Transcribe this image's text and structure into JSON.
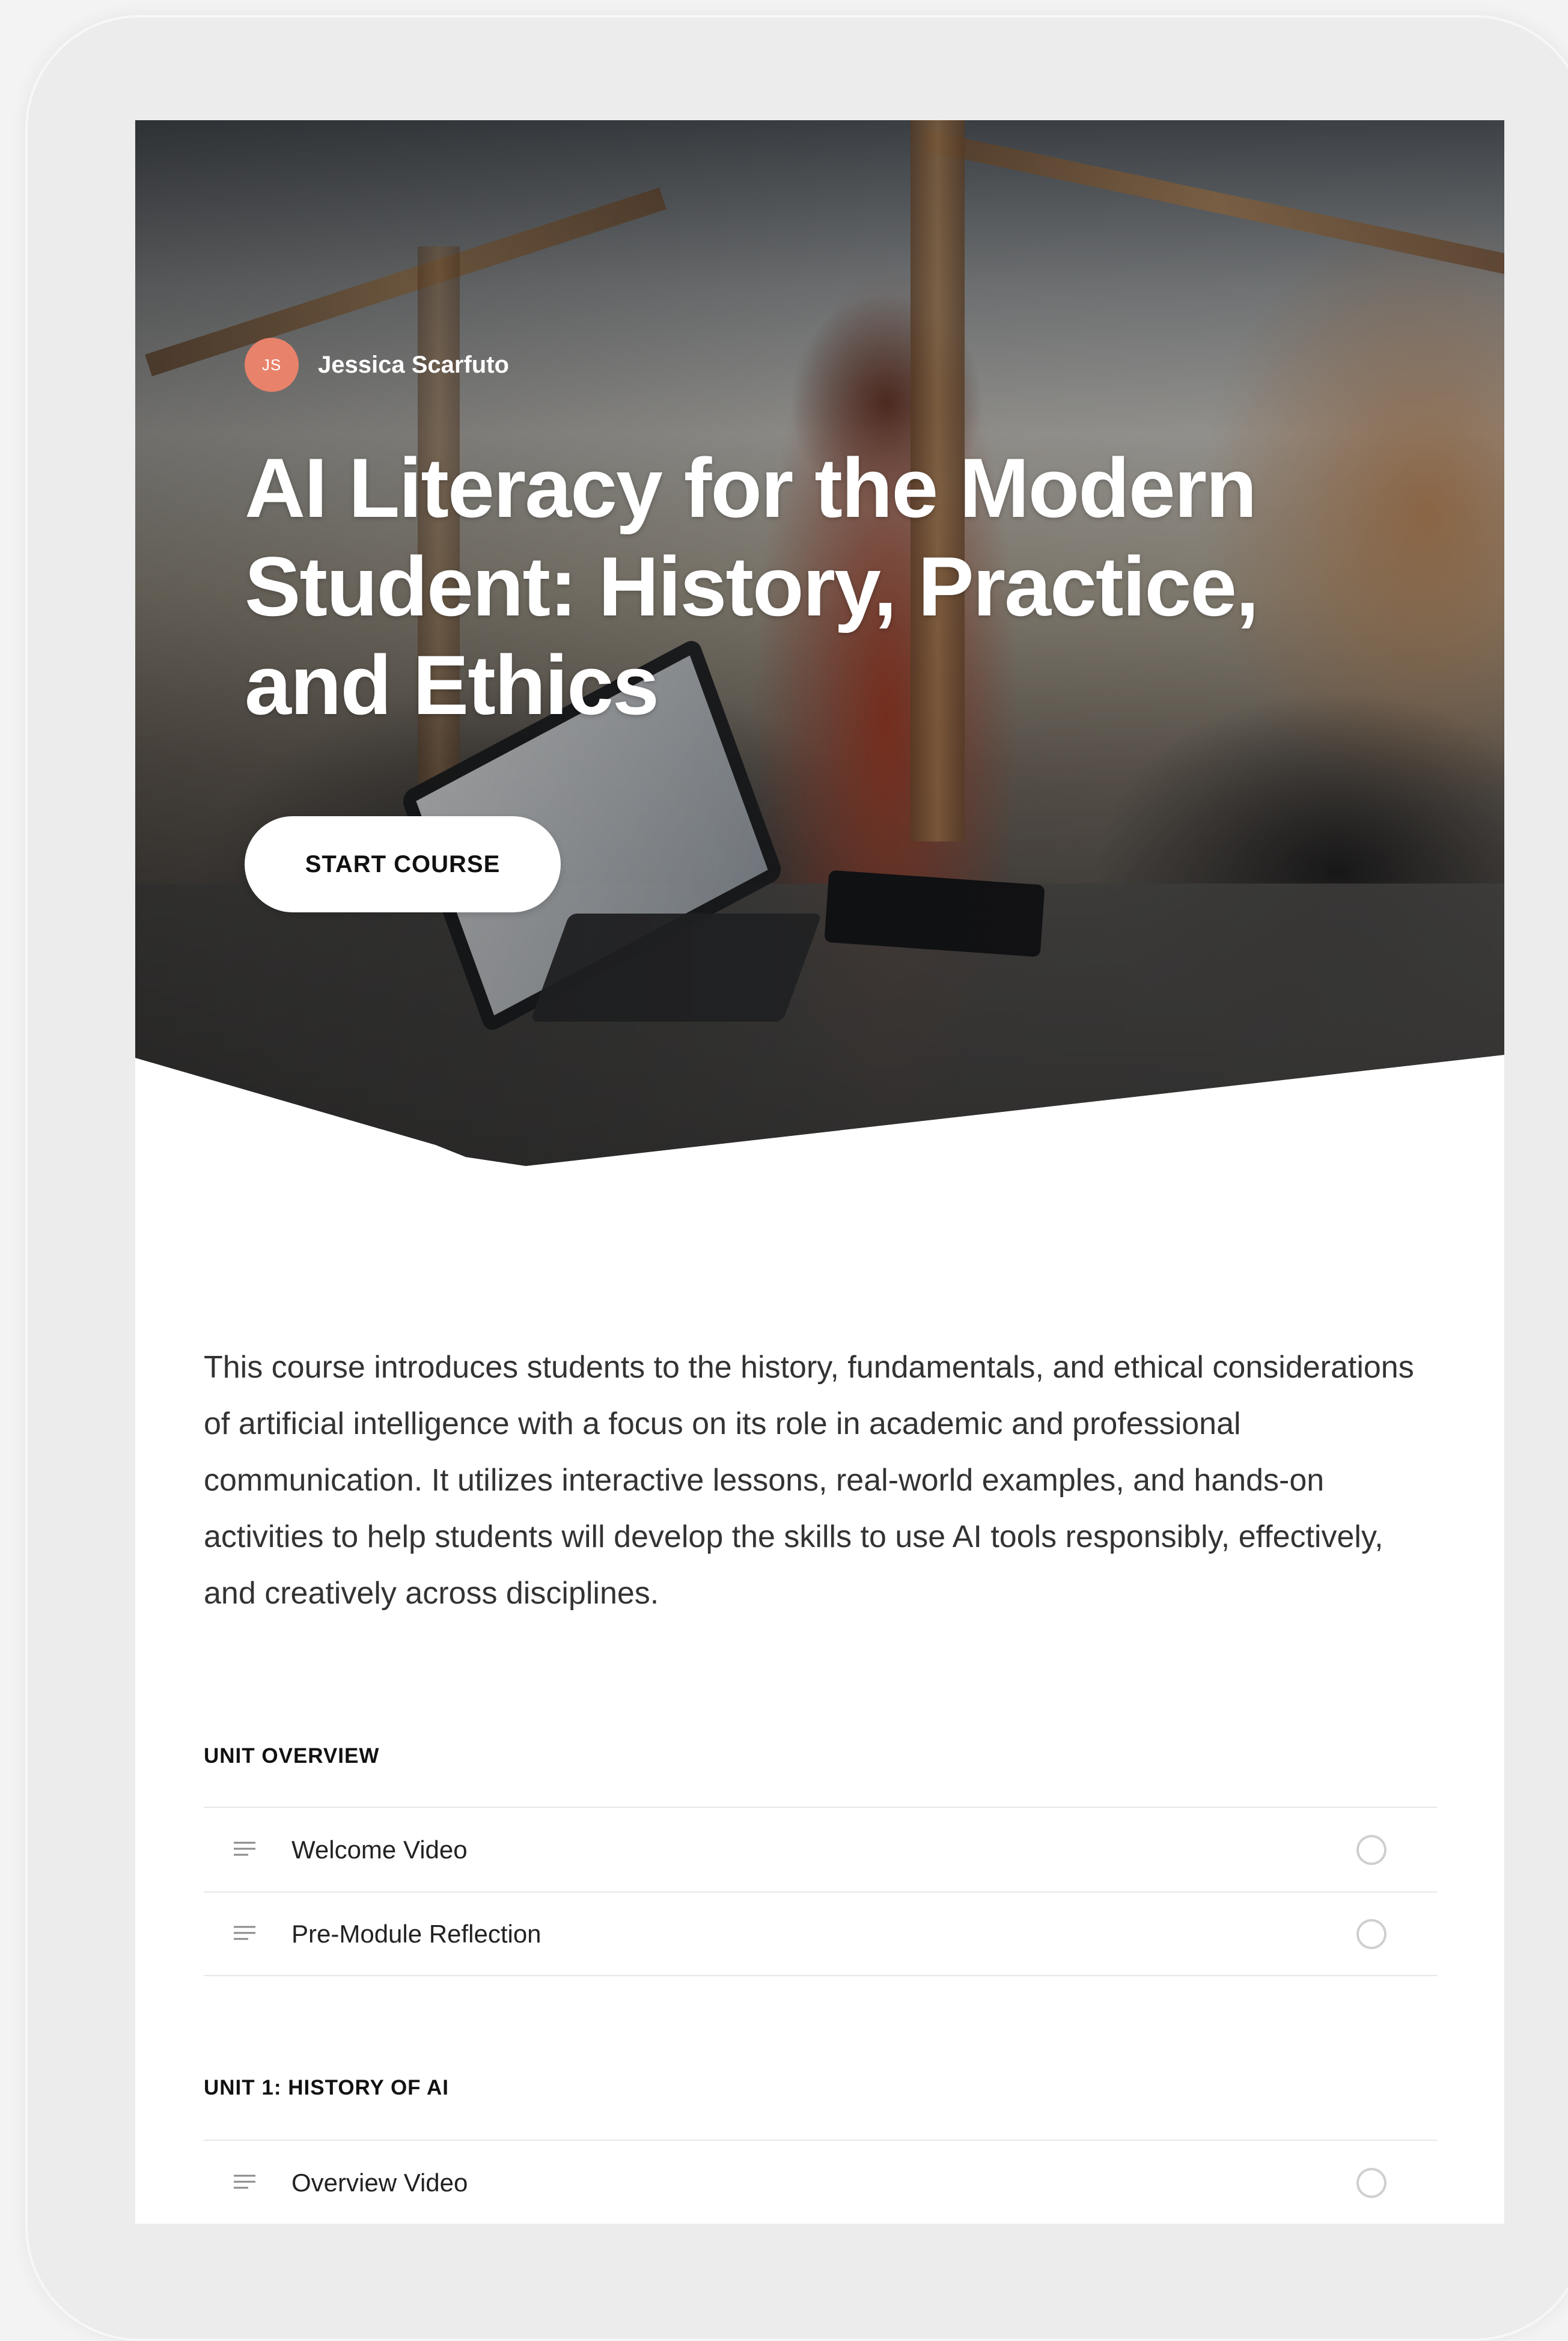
{
  "course": {
    "author_initials": "JS",
    "author_name": "Jessica Scarfuto",
    "title": "AI Literacy for the Modern Student: History, Practice, and Ethics",
    "start_label": "START COURSE",
    "description": "This course introduces students to the history, fundamentals, and ethical considerations of artificial intelligence with a focus on its role in academic and professional communication. It utilizes interactive lessons, real-world examples, and hands-on activities to help students will develop the skills to use AI tools responsibly, effectively, and creatively across disciplines."
  },
  "sections": [
    {
      "heading": "UNIT OVERVIEW",
      "lessons": [
        {
          "title": "Welcome Video",
          "icon": "lesson-text-icon",
          "completed": false
        },
        {
          "title": "Pre-Module Reflection",
          "icon": "lesson-text-icon",
          "completed": false
        }
      ]
    },
    {
      "heading": "UNIT 1: HISTORY OF AI",
      "lessons": [
        {
          "title": "Overview Video",
          "icon": "lesson-text-icon",
          "completed": false
        }
      ]
    }
  ],
  "colors": {
    "avatar": "#e8826b",
    "status_ring": "#cfcfcf"
  }
}
